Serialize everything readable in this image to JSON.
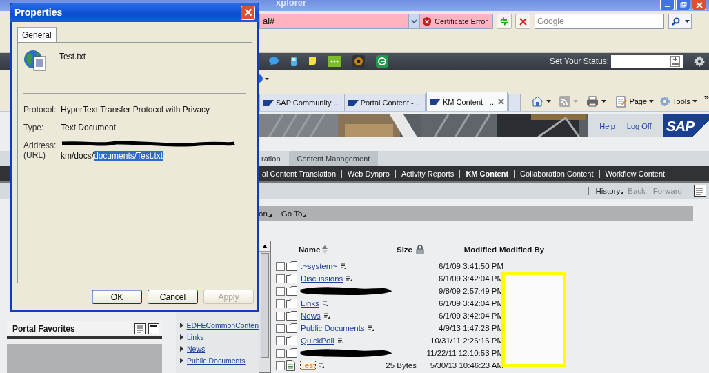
{
  "browser": {
    "title": "xplorer",
    "address": "al#",
    "certificate_error": "Certificate Error",
    "search": {
      "placeholder": "Google"
    },
    "status_label": "Set Your Status:",
    "tabs": [
      {
        "label": "SAP Community ...",
        "selected": false
      },
      {
        "label": "Portal Content - ...",
        "selected": false
      },
      {
        "label": "KM Content - ...",
        "selected": true
      }
    ],
    "commands": [
      "Page",
      "Tools"
    ],
    "more": "»"
  },
  "portal": {
    "links": [
      "Help",
      "Log Off"
    ],
    "logo": "SAP",
    "top_nav": [
      {
        "label": "ration",
        "selected": false
      },
      {
        "label": "Content Management",
        "selected": true
      }
    ],
    "sub_nav": [
      {
        "label": "al Content Translation",
        "selected": false
      },
      {
        "label": "Web Dynpro",
        "selected": false
      },
      {
        "label": "Activity Reports",
        "selected": false
      },
      {
        "label": "KM Content",
        "selected": true
      },
      {
        "label": "Collaboration Content",
        "selected": false
      },
      {
        "label": "Workflow Content",
        "selected": false
      }
    ],
    "history": [
      {
        "label": "History",
        "disabled": false
      },
      {
        "label": "Back",
        "disabled": true
      },
      {
        "label": "Forward",
        "disabled": true
      }
    ],
    "toolbar": [
      "on",
      "Go To"
    ],
    "favorites": {
      "title": "Portal Favorites"
    },
    "tree": [
      "EDFECommonConten",
      "Links",
      "News",
      "Public Documents"
    ],
    "table": {
      "columns": [
        "Name",
        "Size",
        "Modified",
        "Modified By"
      ],
      "rows": [
        {
          "kind": "folder",
          "name": ".~system~",
          "checked": false,
          "redacted": false,
          "visited": false,
          "modified": "6/1/09 3:41:50 PM"
        },
        {
          "kind": "folder",
          "name": "Discussions",
          "checked": false,
          "redacted": false,
          "visited": false,
          "modified": "6/1/09 3:42:04 PM"
        },
        {
          "kind": "folder",
          "checked": false,
          "redacted": true,
          "modified": "9/8/09 2:57:49 PM"
        },
        {
          "kind": "folder",
          "name": "Links",
          "checked": false,
          "redacted": false,
          "visited": false,
          "modified": "6/1/09 3:42:04 PM"
        },
        {
          "kind": "folder",
          "name": "News",
          "checked": false,
          "redacted": false,
          "visited": false,
          "modified": "6/1/09 3:42:04 PM"
        },
        {
          "kind": "folder",
          "name": "Public Documents",
          "checked": false,
          "redacted": false,
          "visited": false,
          "modified": "4/9/13 1:47:28 PM"
        },
        {
          "kind": "folder",
          "name": "QuickPoll",
          "checked": false,
          "redacted": false,
          "visited": false,
          "modified": "10/31/11 2:26:16 PM"
        },
        {
          "kind": "folder",
          "checked": false,
          "redacted": true,
          "modified": "11/22/11 12:10:53 PM"
        },
        {
          "kind": "file",
          "name": "Test",
          "checked": false,
          "redacted": false,
          "visited": true,
          "size": "25 Bytes",
          "modified": "5/30/13 10:46:23 AM"
        }
      ]
    }
  },
  "dialog": {
    "title": "Properties",
    "tabs": [
      {
        "label": "General",
        "selected": true
      }
    ],
    "file_name": "Test.txt",
    "properties": [
      {
        "label": "Protocol:",
        "value": "HyperText Transfer Protocol with Privacy"
      },
      {
        "label": "Type:",
        "value": "Text Document"
      }
    ],
    "address": {
      "label": "Address:",
      "label_2": "(URL)",
      "value": "km/docs/",
      "selected_value": "documents/Test.txt"
    },
    "buttons": [
      {
        "label": "OK",
        "default": true,
        "disabled": false
      },
      {
        "label": "Cancel",
        "default": false,
        "disabled": false
      },
      {
        "label": "Apply",
        "default": false,
        "disabled": true
      }
    ]
  }
}
